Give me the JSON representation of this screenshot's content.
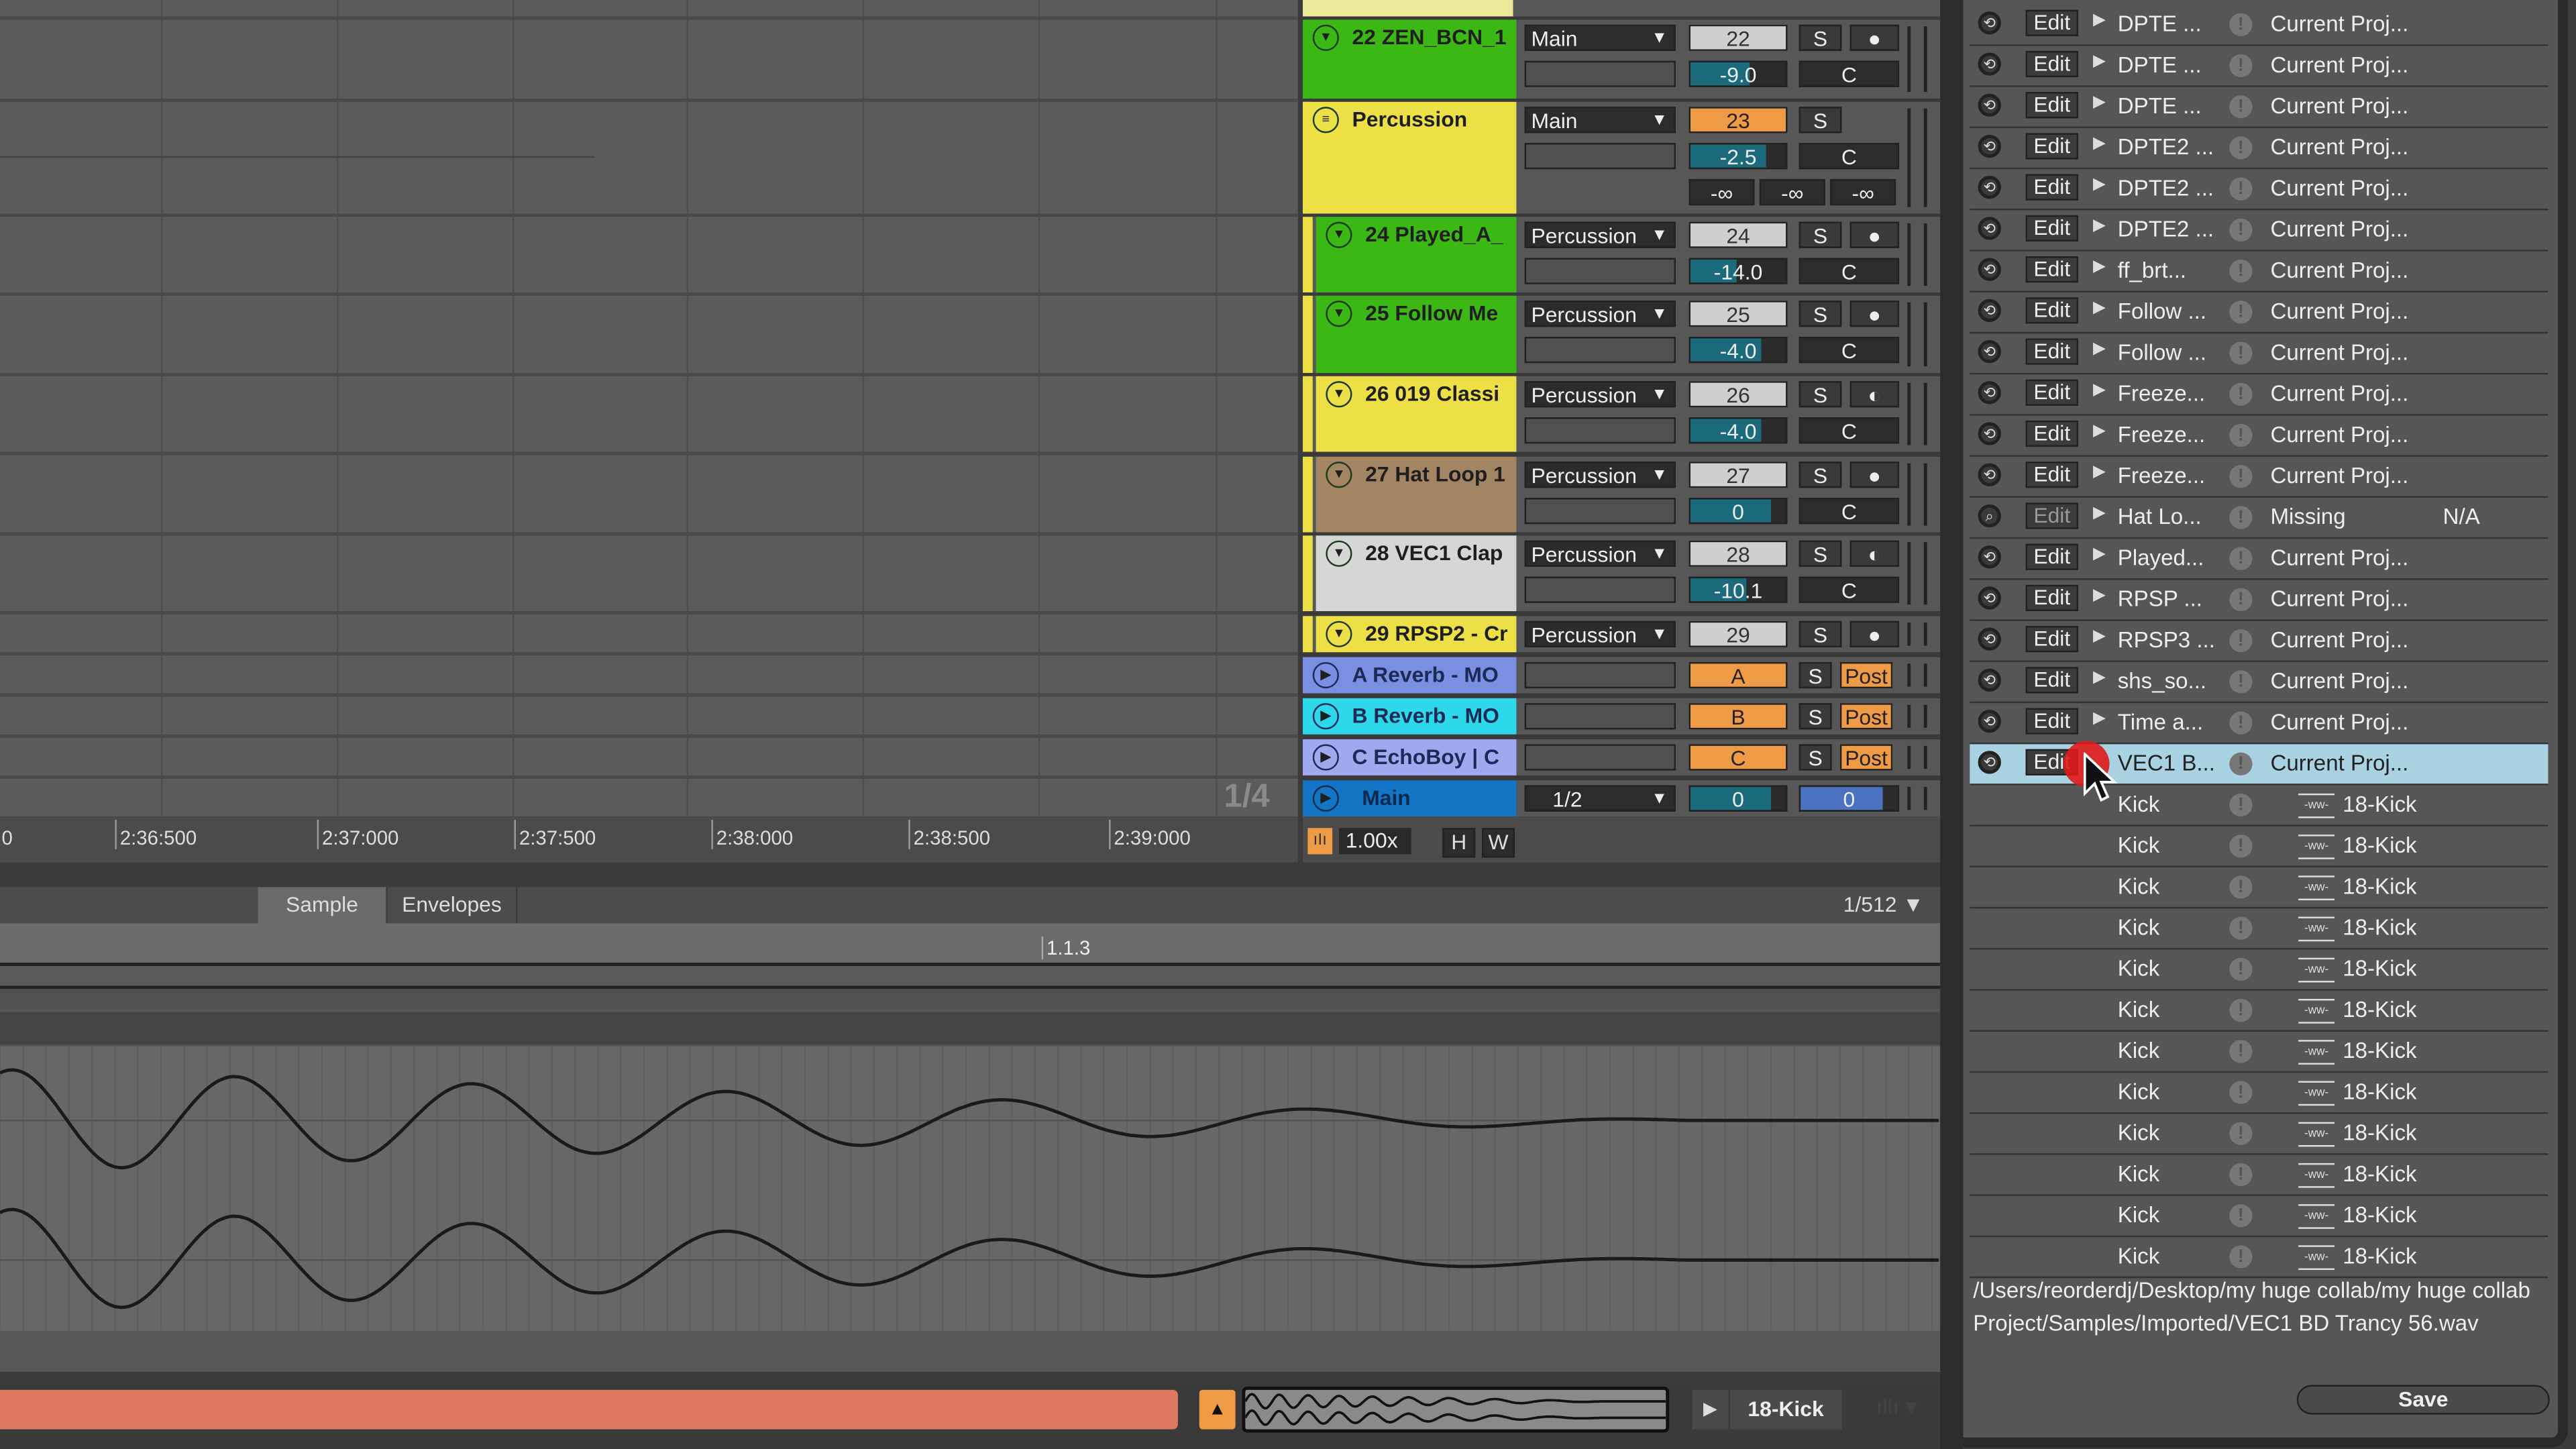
{
  "arrangement": {
    "ruler_ticks": [
      "0",
      "2:36:500",
      "2:37:000",
      "2:37:500",
      "2:38:000",
      "2:38:500",
      "2:39:000"
    ],
    "zoom_fraction": "1/4"
  },
  "tracks": [
    {
      "name": "22 ZEN_BCN_1",
      "color": "#3cb815",
      "icon": "fold-arrow-icon",
      "routing": "Main",
      "number": "22",
      "volume": "-9.0",
      "volume_level": 0.62,
      "button3": "dot"
    },
    {
      "name": "Percussion",
      "color": "#ece046",
      "icon": "group-icon",
      "routing": "Main",
      "number": "23",
      "number_highlight": true,
      "volume": "-2.5",
      "volume_level": 0.8,
      "peaks": [
        "-∞",
        "-∞",
        "-∞"
      ]
    },
    {
      "name": "24 Played_A_",
      "color": "#3cb815",
      "icon": "fold-arrow-icon",
      "routing": "Percussion",
      "number": "24",
      "volume": "-14.0",
      "volume_level": 0.48,
      "button3": "dot"
    },
    {
      "name": "25 Follow Me",
      "color": "#3cb815",
      "icon": "fold-arrow-icon",
      "routing": "Percussion",
      "number": "25",
      "volume": "-4.0",
      "volume_level": 0.74,
      "button3": "dot"
    },
    {
      "name": "26 019 Classi",
      "color": "#ece046",
      "icon": "fold-arrow-icon",
      "routing": "Percussion",
      "number": "26",
      "volume": "-4.0",
      "volume_level": 0.74,
      "button3": "clock"
    },
    {
      "name": "27 Hat Loop 1",
      "color": "#a38463",
      "icon": "fold-arrow-icon",
      "routing": "Percussion",
      "number": "27",
      "volume": "0",
      "volume_level": 0.84,
      "button3": "dot"
    },
    {
      "name": "28 VEC1 Clap",
      "color": "#d6d6d6",
      "icon": "fold-arrow-icon",
      "routing": "Percussion",
      "number": "28",
      "volume": "-10.1",
      "volume_level": 0.58,
      "button3": "clock"
    },
    {
      "name": "29 RPSP2 - Cr",
      "color": "#ece046",
      "icon": "fold-arrow-icon",
      "routing": "Percussion",
      "number": "29",
      "button3": "dot"
    }
  ],
  "returns": [
    {
      "name": "A Reverb - MO",
      "color": "#7a8fe2",
      "letter": "A",
      "solo": "S",
      "post": "Post"
    },
    {
      "name": "B Reverb - MO",
      "color": "#2cd8ea",
      "letter": "B",
      "solo": "S",
      "post": "Post"
    },
    {
      "name": "C EchoBoy | C",
      "color": "#9ea9ef",
      "letter": "C",
      "solo": "S",
      "post": "Post"
    }
  ],
  "main": {
    "name": "Main",
    "color": "#1475c4",
    "routing": "1/2",
    "volume": "0",
    "pan": "0"
  },
  "labels": {
    "solo": "S",
    "center": "C"
  },
  "footer": {
    "zoom": "1.00x",
    "h": "H",
    "w": "W"
  },
  "clip": {
    "tabs": [
      "Sample",
      "Envelopes"
    ],
    "active_tab": "Sample",
    "grid": "1/512 ▼",
    "marker": "1.1.3"
  },
  "bottom": {
    "sample_name": "18-Kick"
  },
  "files": {
    "edit_label": "Edit",
    "rows": [
      {
        "name": "DPTE ...",
        "location": "Current Proj..."
      },
      {
        "name": "DPTE ...",
        "location": "Current Proj..."
      },
      {
        "name": "DPTE ...",
        "location": "Current Proj..."
      },
      {
        "name": "DPTE2 ...",
        "location": "Current Proj..."
      },
      {
        "name": "DPTE2 ...",
        "location": "Current Proj..."
      },
      {
        "name": "DPTE2 ...",
        "location": "Current Proj..."
      },
      {
        "name": "ff_brt...",
        "location": "Current Proj..."
      },
      {
        "name": "Follow ...",
        "location": "Current Proj..."
      },
      {
        "name": "Follow ...",
        "location": "Current Proj..."
      },
      {
        "name": "Freeze...",
        "location": "Current Proj..."
      },
      {
        "name": "Freeze...",
        "location": "Current Proj..."
      },
      {
        "name": "Freeze...",
        "location": "Current Proj..."
      },
      {
        "name": "Hat Lo...",
        "location": "Missing",
        "extra": "N/A",
        "missing": true
      },
      {
        "name": "Played...",
        "location": "Current Proj..."
      },
      {
        "name": "RPSP ...",
        "location": "Current Proj..."
      },
      {
        "name": "RPSP3 ...",
        "location": "Current Proj..."
      },
      {
        "name": "shs_so...",
        "location": "Current Proj..."
      },
      {
        "name": "Time a...",
        "location": "Current Proj..."
      },
      {
        "name": "VEC1 B...",
        "location": "Current Proj...",
        "selected": true
      }
    ],
    "sub_rows": [
      {
        "track": "Kick",
        "clip": "18-Kick"
      },
      {
        "track": "Kick",
        "clip": "18-Kick"
      },
      {
        "track": "Kick",
        "clip": "18-Kick"
      },
      {
        "track": "Kick",
        "clip": "18-Kick"
      },
      {
        "track": "Kick",
        "clip": "18-Kick"
      },
      {
        "track": "Kick",
        "clip": "18-Kick"
      },
      {
        "track": "Kick",
        "clip": "18-Kick"
      },
      {
        "track": "Kick",
        "clip": "18-Kick"
      },
      {
        "track": "Kick",
        "clip": "18-Kick"
      },
      {
        "track": "Kick",
        "clip": "18-Kick"
      },
      {
        "track": "Kick",
        "clip": "18-Kick"
      },
      {
        "track": "Kick",
        "clip": "18-Kick"
      }
    ],
    "path": "/Users/reorderdj/Desktop/my huge collab/my huge collab Project/Samples/Imported/VEC1 BD Trancy 56.wav",
    "save_label": "Save"
  }
}
